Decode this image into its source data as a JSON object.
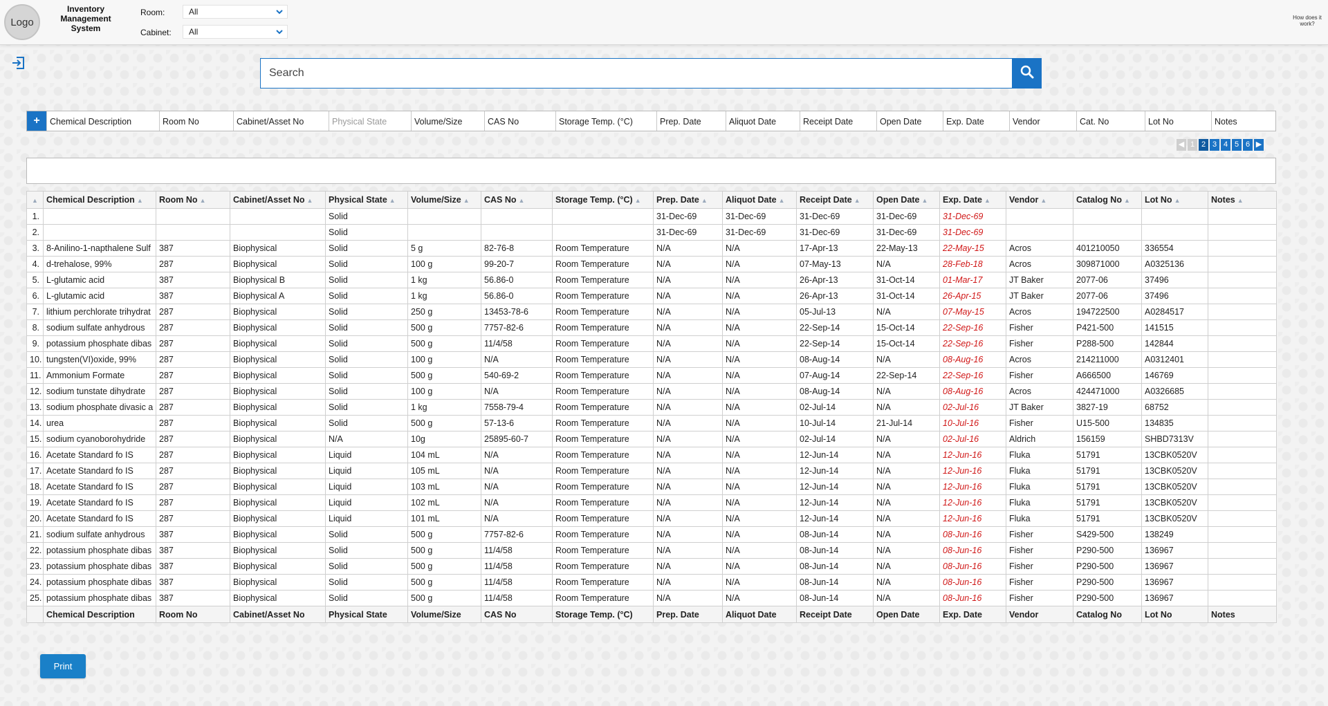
{
  "header": {
    "logo_text": "Logo",
    "app_title": "Inventory Management System",
    "room_label": "Room:",
    "room_value": "All",
    "cabinet_label": "Cabinet:",
    "cabinet_value": "All",
    "help_text": "How does it work?"
  },
  "search": {
    "placeholder": "Search"
  },
  "column_picker": {
    "add_label": "+",
    "columns": [
      {
        "label": "Chemical Description",
        "dim": false
      },
      {
        "label": "Room No",
        "dim": false
      },
      {
        "label": "Cabinet/Asset No",
        "dim": false
      },
      {
        "label": "Physical State",
        "dim": true
      },
      {
        "label": "Volume/Size",
        "dim": false
      },
      {
        "label": "CAS No",
        "dim": false
      },
      {
        "label": "Storage Temp. (°C)",
        "dim": false
      },
      {
        "label": "Prep. Date",
        "dim": false
      },
      {
        "label": "Aliquot Date",
        "dim": false
      },
      {
        "label": "Receipt Date",
        "dim": false
      },
      {
        "label": "Open Date",
        "dim": false
      },
      {
        "label": "Exp. Date",
        "dim": false
      },
      {
        "label": "Vendor",
        "dim": false
      },
      {
        "label": "Cat. No",
        "dim": false
      },
      {
        "label": "Lot No",
        "dim": false
      },
      {
        "label": "Notes",
        "dim": false
      }
    ]
  },
  "pagination": {
    "prev": "◀",
    "pages": [
      "1",
      "2",
      "3",
      "4",
      "5",
      "6"
    ],
    "current": "2",
    "next": "▶"
  },
  "table": {
    "headers": [
      "Chemical Description",
      "Room No",
      "Cabinet/Asset No",
      "Physical State",
      "Volume/Size",
      "CAS No",
      "Storage Temp. (°C)",
      "Prep. Date",
      "Aliquot Date",
      "Receipt Date",
      "Open Date",
      "Exp. Date",
      "Vendor",
      "Catalog No",
      "Lot No",
      "Notes"
    ],
    "rows": [
      [
        "1.",
        "",
        "",
        "Solid",
        "",
        "",
        "",
        "31-Dec-69",
        "31-Dec-69",
        "31-Dec-69",
        "31-Dec-69",
        "31-Dec-69",
        "",
        "",
        "",
        ""
      ],
      [
        "2.",
        "",
        "",
        "Solid",
        "",
        "",
        "",
        "31-Dec-69",
        "31-Dec-69",
        "31-Dec-69",
        "31-Dec-69",
        "31-Dec-69",
        "",
        "",
        "",
        ""
      ],
      [
        "3.",
        "8-Anilino-1-napthalene Sulf",
        "387",
        "Biophysical",
        "Solid",
        "5 g",
        "82-76-8",
        "Room Temperature",
        "N/A",
        "N/A",
        "17-Apr-13",
        "22-May-13",
        "22-May-15",
        "Acros",
        "401210050",
        "336554",
        ""
      ],
      [
        "4.",
        "d-trehalose, 99%",
        "287",
        "Biophysical",
        "Solid",
        "100 g",
        "99-20-7",
        "Room Temperature",
        "N/A",
        "N/A",
        "07-May-13",
        "N/A",
        "28-Feb-18",
        "Acros",
        "309871000",
        "A0325136",
        ""
      ],
      [
        "5.",
        "L-glutamic acid",
        "387",
        "Biophysical B",
        "Solid",
        "1 kg",
        "56.86-0",
        "Room Temperature",
        "N/A",
        "N/A",
        "26-Apr-13",
        "31-Oct-14",
        "01-Mar-17",
        "JT Baker",
        "2077-06",
        "37496",
        ""
      ],
      [
        "6.",
        "L-glutamic acid",
        "387",
        "Biophysical A",
        "Solid",
        "1 kg",
        "56.86-0",
        "Room Temperature",
        "N/A",
        "N/A",
        "26-Apr-13",
        "31-Oct-14",
        "26-Apr-15",
        "JT Baker",
        "2077-06",
        "37496",
        ""
      ],
      [
        "7.",
        "lithium perchlorate trihydrat",
        "287",
        "Biophysical",
        "Solid",
        "250 g",
        "13453-78-6",
        "Room Temperature",
        "N/A",
        "N/A",
        "05-Jul-13",
        "N/A",
        "07-May-15",
        "Acros",
        "194722500",
        "A0284517",
        ""
      ],
      [
        "8.",
        "sodium sulfate anhydrous",
        "287",
        "Biophysical",
        "Solid",
        "500 g",
        "7757-82-6",
        "Room Temperature",
        "N/A",
        "N/A",
        "22-Sep-14",
        "15-Oct-14",
        "22-Sep-16",
        "Fisher",
        "P421-500",
        "141515",
        ""
      ],
      [
        "9.",
        "potassium phosphate dibas",
        "287",
        "Biophysical",
        "Solid",
        "500 g",
        "11/4/58",
        "Room Temperature",
        "N/A",
        "N/A",
        "22-Sep-14",
        "15-Oct-14",
        "22-Sep-16",
        "Fisher",
        "P288-500",
        "142844",
        ""
      ],
      [
        "10.",
        "tungsten(VI)oxide, 99%",
        "287",
        "Biophysical",
        "Solid",
        "100 g",
        "N/A",
        "Room Temperature",
        "N/A",
        "N/A",
        "08-Aug-14",
        "N/A",
        "08-Aug-16",
        "Acros",
        "214211000",
        "A0312401",
        ""
      ],
      [
        "11.",
        "Ammonium Formate",
        "287",
        "Biophysical",
        "Solid",
        "500 g",
        "540-69-2",
        "Room Temperature",
        "N/A",
        "N/A",
        "07-Aug-14",
        "22-Sep-14",
        "22-Sep-16",
        "Fisher",
        "A666500",
        "146769",
        ""
      ],
      [
        "12.",
        "sodium tunstate dihydrate",
        "287",
        "Biophysical",
        "Solid",
        "100 g",
        "N/A",
        "Room Temperature",
        "N/A",
        "N/A",
        "08-Aug-14",
        "N/A",
        "08-Aug-16",
        "Acros",
        "424471000",
        "A0326685",
        ""
      ],
      [
        "13.",
        "sodium phosphate divasic a",
        "287",
        "Biophysical",
        "Solid",
        "1 kg",
        "7558-79-4",
        "Room Temperature",
        "N/A",
        "N/A",
        "02-Jul-14",
        "N/A",
        "02-Jul-16",
        "JT Baker",
        "3827-19",
        "68752",
        ""
      ],
      [
        "14.",
        "urea",
        "287",
        "Biophysical",
        "Solid",
        "500 g",
        "57-13-6",
        "Room Temperature",
        "N/A",
        "N/A",
        "10-Jul-14",
        "21-Jul-14",
        "10-Jul-16",
        "Fisher",
        "U15-500",
        "134835",
        ""
      ],
      [
        "15.",
        "sodium cyanoborohydride",
        "287",
        "Biophysical",
        "N/A",
        "10g",
        "25895-60-7",
        "Room Temperature",
        "N/A",
        "N/A",
        "02-Jul-14",
        "N/A",
        "02-Jul-16",
        "Aldrich",
        "156159",
        "SHBD7313V",
        ""
      ],
      [
        "16.",
        "Acetate Standard fo IS",
        "287",
        "Biophysical",
        "Liquid",
        "104 mL",
        "N/A",
        "Room Temperature",
        "N/A",
        "N/A",
        "12-Jun-14",
        "N/A",
        "12-Jun-16",
        "Fluka",
        "51791",
        "13CBK0520V",
        ""
      ],
      [
        "17.",
        "Acetate Standard fo IS",
        "287",
        "Biophysical",
        "Liquid",
        "105 mL",
        "N/A",
        "Room Temperature",
        "N/A",
        "N/A",
        "12-Jun-14",
        "N/A",
        "12-Jun-16",
        "Fluka",
        "51791",
        "13CBK0520V",
        ""
      ],
      [
        "18.",
        "Acetate Standard fo IS",
        "287",
        "Biophysical",
        "Liquid",
        "103 mL",
        "N/A",
        "Room Temperature",
        "N/A",
        "N/A",
        "12-Jun-14",
        "N/A",
        "12-Jun-16",
        "Fluka",
        "51791",
        "13CBK0520V",
        ""
      ],
      [
        "19.",
        "Acetate Standard fo IS",
        "287",
        "Biophysical",
        "Liquid",
        "102 mL",
        "N/A",
        "Room Temperature",
        "N/A",
        "N/A",
        "12-Jun-14",
        "N/A",
        "12-Jun-16",
        "Fluka",
        "51791",
        "13CBK0520V",
        ""
      ],
      [
        "20.",
        "Acetate Standard fo IS",
        "287",
        "Biophysical",
        "Liquid",
        "101 mL",
        "N/A",
        "Room Temperature",
        "N/A",
        "N/A",
        "12-Jun-14",
        "N/A",
        "12-Jun-16",
        "Fluka",
        "51791",
        "13CBK0520V",
        ""
      ],
      [
        "21.",
        "sodium sulfate anhydrous",
        "387",
        "Biophysical",
        "Solid",
        "500 g",
        "7757-82-6",
        "Room Temperature",
        "N/A",
        "N/A",
        "08-Jun-14",
        "N/A",
        "08-Jun-16",
        "Fisher",
        "S429-500",
        "138249",
        ""
      ],
      [
        "22.",
        "potassium phosphate dibas",
        "387",
        "Biophysical",
        "Solid",
        "500 g",
        "11/4/58",
        "Room Temperature",
        "N/A",
        "N/A",
        "08-Jun-14",
        "N/A",
        "08-Jun-16",
        "Fisher",
        "P290-500",
        "136967",
        ""
      ],
      [
        "23.",
        "potassium phosphate dibas",
        "387",
        "Biophysical",
        "Solid",
        "500 g",
        "11/4/58",
        "Room Temperature",
        "N/A",
        "N/A",
        "08-Jun-14",
        "N/A",
        "08-Jun-16",
        "Fisher",
        "P290-500",
        "136967",
        ""
      ],
      [
        "24.",
        "potassium phosphate dibas",
        "387",
        "Biophysical",
        "Solid",
        "500 g",
        "11/4/58",
        "Room Temperature",
        "N/A",
        "N/A",
        "08-Jun-14",
        "N/A",
        "08-Jun-16",
        "Fisher",
        "P290-500",
        "136967",
        ""
      ],
      [
        "25.",
        "potassium phosphate dibas",
        "387",
        "Biophysical",
        "Solid",
        "500 g",
        "11/4/58",
        "Room Temperature",
        "N/A",
        "N/A",
        "08-Jun-14",
        "N/A",
        "08-Jun-16",
        "Fisher",
        "P290-500",
        "136967",
        ""
      ]
    ]
  },
  "print_label": "Print",
  "colors": {
    "accent": "#1a73c5",
    "expired": "#d01818"
  },
  "icons": {
    "logout": "logout-icon",
    "search": "search-icon",
    "sort": "sort-up-icon",
    "dropdown": "chevron-down-icon"
  }
}
